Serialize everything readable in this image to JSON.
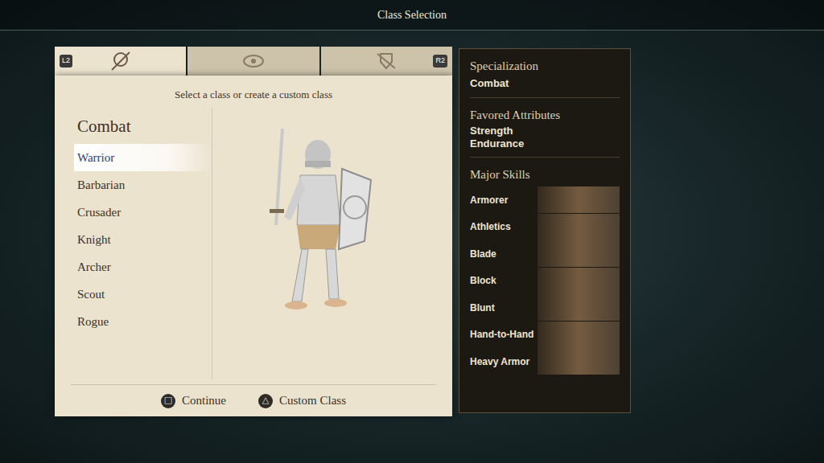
{
  "window": {
    "title": "Class Selection"
  },
  "tabs": [
    {
      "selected": true
    },
    {
      "selected": false
    },
    {
      "selected": false
    }
  ],
  "tab_keys": {
    "prev": "L2",
    "next": "R2"
  },
  "panel": {
    "instruction": "Select a class or create a custom class",
    "category": "Combat",
    "classes": [
      {
        "label": "Warrior",
        "selected": true
      },
      {
        "label": "Barbarian",
        "selected": false
      },
      {
        "label": "Crusader",
        "selected": false
      },
      {
        "label": "Knight",
        "selected": false
      },
      {
        "label": "Archer",
        "selected": false
      },
      {
        "label": "Scout",
        "selected": false
      },
      {
        "label": "Rogue",
        "selected": false
      }
    ]
  },
  "footer": {
    "buttons": [
      {
        "glyph": "□",
        "label": "Continue"
      },
      {
        "glyph": "△",
        "label": "Custom Class"
      }
    ]
  },
  "details": {
    "specialization": {
      "heading": "Specialization",
      "value": "Combat"
    },
    "attributes": {
      "heading": "Favored Attributes",
      "values": [
        "Strength",
        "Endurance"
      ]
    },
    "skills": {
      "heading": "Major Skills",
      "items": [
        "Armorer",
        "Athletics",
        "Blade",
        "Block",
        "Blunt",
        "Hand-to-Hand",
        "Heavy Armor"
      ]
    }
  }
}
